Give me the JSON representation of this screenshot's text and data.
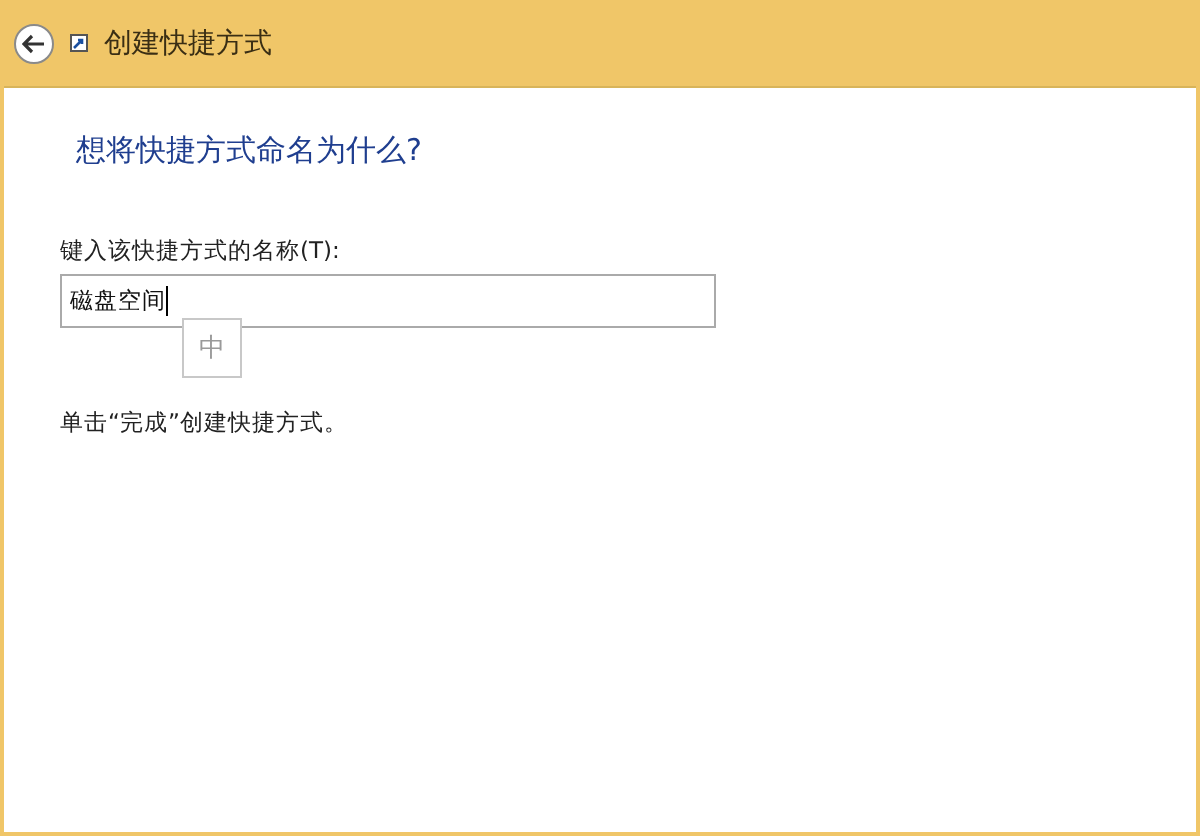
{
  "window": {
    "title": "创建快捷方式"
  },
  "heading": "想将快捷方式命名为什么?",
  "name_field": {
    "label": "键入该快捷方式的名称(T):",
    "value": "磁盘空间"
  },
  "ime_indicator": "中",
  "instruction": "单击“完成”创建快捷方式。"
}
